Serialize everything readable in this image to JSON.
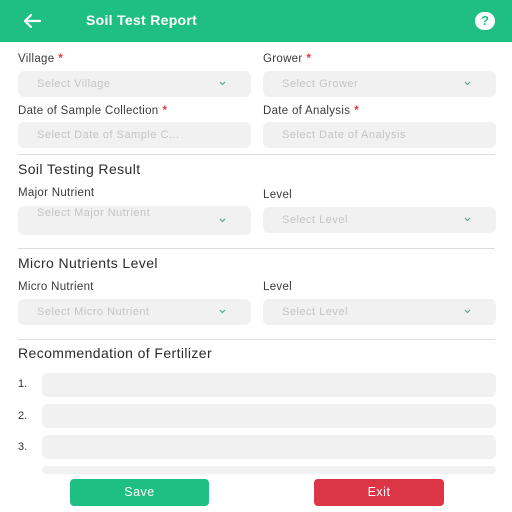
{
  "app": {
    "title": "Soil Test Report",
    "back_icon": "arrow-left-icon",
    "help_icon": "question-circle-icon",
    "help_glyph": "?",
    "accent_color": "#1fbf83",
    "danger_color": "#dc3545"
  },
  "sample": {
    "village": {
      "label": "Village",
      "required_mark": "*",
      "placeholder": "Select Village"
    },
    "grower": {
      "label": "Grower",
      "required_mark": "*",
      "placeholder": "Select Grower"
    },
    "collection_date": {
      "label": "Date of Sample Collection",
      "required_mark": "*",
      "placeholder": "Select Date of Sample C..."
    },
    "analysis_date": {
      "label": "Date of Analysis",
      "required_mark": "*",
      "placeholder": "Select Date of Analysis"
    }
  },
  "soil_testing": {
    "heading": "Soil Testing Result",
    "major_nutrient": {
      "label": "Major Nutrient",
      "placeholder": "Select Major Nutrient"
    },
    "level": {
      "label": "Level",
      "placeholder": "Select Level"
    }
  },
  "micro_nutrients": {
    "heading": "Micro Nutrients Level",
    "micro_nutrient": {
      "label": "Micro Nutrient",
      "placeholder": "Select Micro Nutrient"
    },
    "level": {
      "label": "Level",
      "placeholder": "Select Level"
    }
  },
  "recommendation": {
    "heading": "Recommendation of Fertilizer",
    "items": [
      {
        "number": "1.",
        "value": ""
      },
      {
        "number": "2.",
        "value": ""
      },
      {
        "number": "3.",
        "value": ""
      }
    ]
  },
  "actions": {
    "save_label": "Save",
    "exit_label": "Exit"
  }
}
